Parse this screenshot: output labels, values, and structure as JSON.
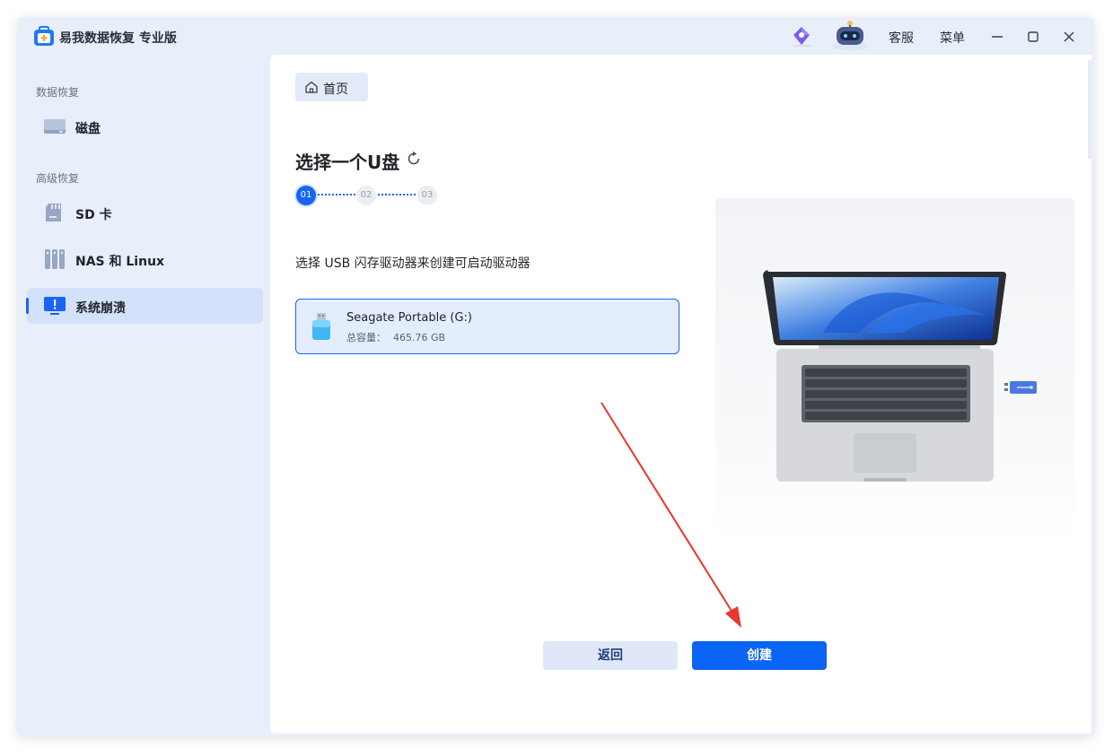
{
  "app": {
    "title": "易我数据恢复 专业版",
    "icons": [
      "app-logo-icon",
      "diamond-icon",
      "robot-assistant-icon"
    ]
  },
  "titlebar": {
    "support_label": "客服",
    "menu_label": "菜单",
    "window_controls": [
      "minimize-icon",
      "maximize-icon",
      "close-icon"
    ]
  },
  "sidebar": {
    "section_data": "数据恢复",
    "section_advanced": "高级恢复",
    "items": [
      {
        "label": "磁盘",
        "icon": "disk-icon",
        "active": false
      },
      {
        "label": "SD 卡",
        "icon": "sd-card-icon",
        "active": false
      },
      {
        "label": "NAS 和 Linux",
        "icon": "nas-icon",
        "active": false
      },
      {
        "label": "系统崩溃",
        "icon": "system-crash-icon",
        "active": true
      }
    ]
  },
  "breadcrumb": {
    "home_label": "首页",
    "icon": "home-icon"
  },
  "page": {
    "title": "选择一个U盘",
    "steps": [
      "01",
      "02",
      "03"
    ],
    "current_step": "01",
    "instruction": "选择 USB 闪存驱动器来创建可启动驱动器"
  },
  "drive": {
    "name": "Seagate Portable (G:)",
    "capacity_label": "总容量：",
    "capacity_value": "465.76 GB",
    "icon": "usb-drive-icon",
    "selected": true
  },
  "actions": {
    "back_label": "返回",
    "create_label": "创建"
  },
  "colors": {
    "accent": "#1764f5",
    "sidebar_bg": "#e9effa",
    "active_item_bg": "#d4e1fb",
    "annotation_arrow": "#e8382f"
  }
}
